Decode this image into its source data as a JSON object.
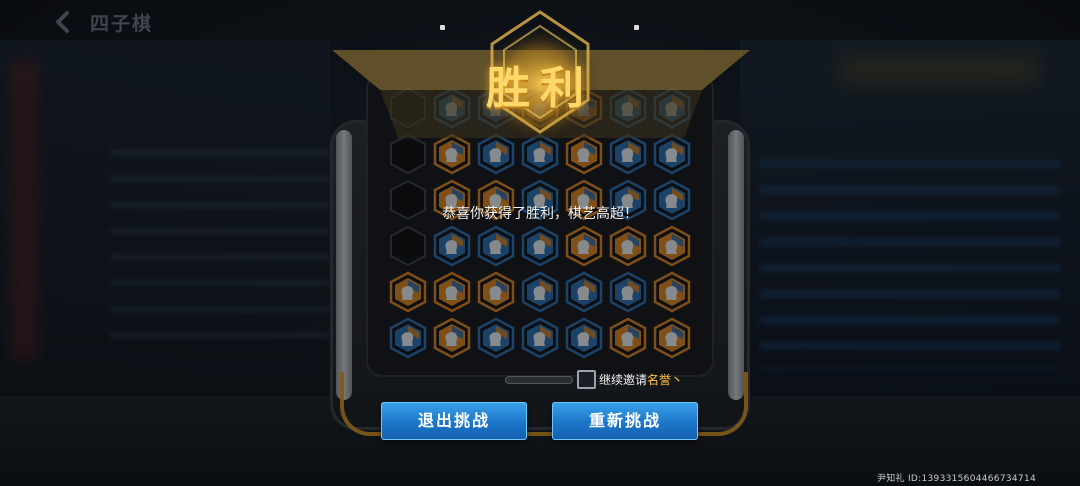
{
  "header": {
    "title": "四子棋",
    "back_icon": "chevron-left-icon"
  },
  "result": {
    "title": "胜利",
    "message": "恭喜你获得了胜利，棋艺高超！"
  },
  "invite": {
    "label_prefix": "继续邀请",
    "highlight": "名誉丶",
    "checked": false
  },
  "buttons": {
    "exit": "退出挑战",
    "retry": "重新挑战"
  },
  "footer": {
    "user_line": "尹知礼  ID:1393315604466734714"
  },
  "board": {
    "columns": 7,
    "rows": 6,
    "grid": [
      [
        "empty",
        "blue",
        "blue",
        "orange",
        "orange",
        "blue",
        "blue"
      ],
      [
        "empty",
        "orange",
        "blue",
        "blue",
        "orange",
        "blue",
        "blue"
      ],
      [
        "empty",
        "orange",
        "orange",
        "blue",
        "orange",
        "blue",
        "blue"
      ],
      [
        "empty",
        "blue",
        "blue",
        "blue",
        "orange",
        "orange",
        "orange"
      ],
      [
        "orange",
        "orange",
        "orange",
        "blue",
        "blue",
        "blue",
        "orange"
      ],
      [
        "blue",
        "orange",
        "blue",
        "blue",
        "blue",
        "orange",
        "orange"
      ]
    ]
  },
  "colors": {
    "accent_gold": "#ffd86a",
    "button_blue": "#1c76c8",
    "piece_orange": "#e0871f",
    "piece_blue": "#2a6fb5",
    "highlight_gold": "#ffc43a"
  }
}
